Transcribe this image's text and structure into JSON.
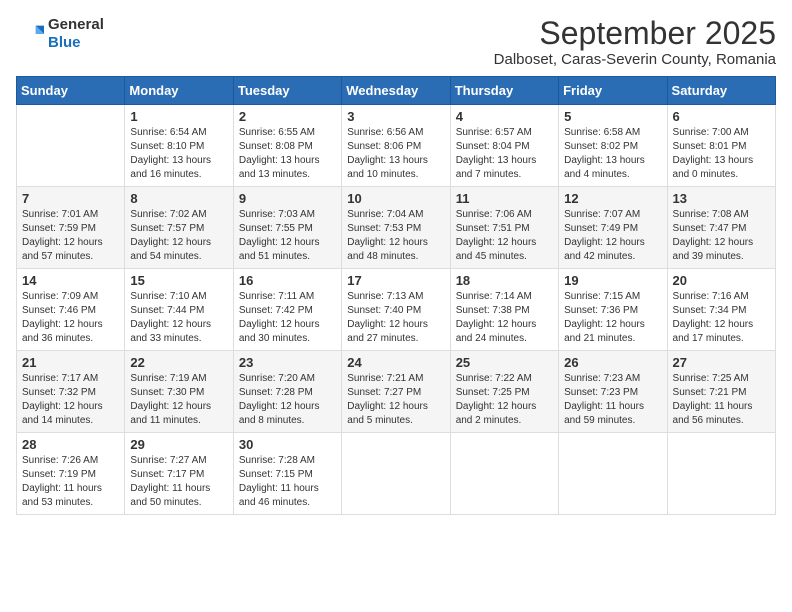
{
  "logo": {
    "general": "General",
    "blue": "Blue"
  },
  "header": {
    "month": "September 2025",
    "location": "Dalboset, Caras-Severin County, Romania"
  },
  "weekdays": [
    "Sunday",
    "Monday",
    "Tuesday",
    "Wednesday",
    "Thursday",
    "Friday",
    "Saturday"
  ],
  "weeks": [
    [
      {
        "day": "",
        "sunrise": "",
        "sunset": "",
        "daylight": ""
      },
      {
        "day": "1",
        "sunrise": "Sunrise: 6:54 AM",
        "sunset": "Sunset: 8:10 PM",
        "daylight": "Daylight: 13 hours and 16 minutes."
      },
      {
        "day": "2",
        "sunrise": "Sunrise: 6:55 AM",
        "sunset": "Sunset: 8:08 PM",
        "daylight": "Daylight: 13 hours and 13 minutes."
      },
      {
        "day": "3",
        "sunrise": "Sunrise: 6:56 AM",
        "sunset": "Sunset: 8:06 PM",
        "daylight": "Daylight: 13 hours and 10 minutes."
      },
      {
        "day": "4",
        "sunrise": "Sunrise: 6:57 AM",
        "sunset": "Sunset: 8:04 PM",
        "daylight": "Daylight: 13 hours and 7 minutes."
      },
      {
        "day": "5",
        "sunrise": "Sunrise: 6:58 AM",
        "sunset": "Sunset: 8:02 PM",
        "daylight": "Daylight: 13 hours and 4 minutes."
      },
      {
        "day": "6",
        "sunrise": "Sunrise: 7:00 AM",
        "sunset": "Sunset: 8:01 PM",
        "daylight": "Daylight: 13 hours and 0 minutes."
      }
    ],
    [
      {
        "day": "7",
        "sunrise": "Sunrise: 7:01 AM",
        "sunset": "Sunset: 7:59 PM",
        "daylight": "Daylight: 12 hours and 57 minutes."
      },
      {
        "day": "8",
        "sunrise": "Sunrise: 7:02 AM",
        "sunset": "Sunset: 7:57 PM",
        "daylight": "Daylight: 12 hours and 54 minutes."
      },
      {
        "day": "9",
        "sunrise": "Sunrise: 7:03 AM",
        "sunset": "Sunset: 7:55 PM",
        "daylight": "Daylight: 12 hours and 51 minutes."
      },
      {
        "day": "10",
        "sunrise": "Sunrise: 7:04 AM",
        "sunset": "Sunset: 7:53 PM",
        "daylight": "Daylight: 12 hours and 48 minutes."
      },
      {
        "day": "11",
        "sunrise": "Sunrise: 7:06 AM",
        "sunset": "Sunset: 7:51 PM",
        "daylight": "Daylight: 12 hours and 45 minutes."
      },
      {
        "day": "12",
        "sunrise": "Sunrise: 7:07 AM",
        "sunset": "Sunset: 7:49 PM",
        "daylight": "Daylight: 12 hours and 42 minutes."
      },
      {
        "day": "13",
        "sunrise": "Sunrise: 7:08 AM",
        "sunset": "Sunset: 7:47 PM",
        "daylight": "Daylight: 12 hours and 39 minutes."
      }
    ],
    [
      {
        "day": "14",
        "sunrise": "Sunrise: 7:09 AM",
        "sunset": "Sunset: 7:46 PM",
        "daylight": "Daylight: 12 hours and 36 minutes."
      },
      {
        "day": "15",
        "sunrise": "Sunrise: 7:10 AM",
        "sunset": "Sunset: 7:44 PM",
        "daylight": "Daylight: 12 hours and 33 minutes."
      },
      {
        "day": "16",
        "sunrise": "Sunrise: 7:11 AM",
        "sunset": "Sunset: 7:42 PM",
        "daylight": "Daylight: 12 hours and 30 minutes."
      },
      {
        "day": "17",
        "sunrise": "Sunrise: 7:13 AM",
        "sunset": "Sunset: 7:40 PM",
        "daylight": "Daylight: 12 hours and 27 minutes."
      },
      {
        "day": "18",
        "sunrise": "Sunrise: 7:14 AM",
        "sunset": "Sunset: 7:38 PM",
        "daylight": "Daylight: 12 hours and 24 minutes."
      },
      {
        "day": "19",
        "sunrise": "Sunrise: 7:15 AM",
        "sunset": "Sunset: 7:36 PM",
        "daylight": "Daylight: 12 hours and 21 minutes."
      },
      {
        "day": "20",
        "sunrise": "Sunrise: 7:16 AM",
        "sunset": "Sunset: 7:34 PM",
        "daylight": "Daylight: 12 hours and 17 minutes."
      }
    ],
    [
      {
        "day": "21",
        "sunrise": "Sunrise: 7:17 AM",
        "sunset": "Sunset: 7:32 PM",
        "daylight": "Daylight: 12 hours and 14 minutes."
      },
      {
        "day": "22",
        "sunrise": "Sunrise: 7:19 AM",
        "sunset": "Sunset: 7:30 PM",
        "daylight": "Daylight: 12 hours and 11 minutes."
      },
      {
        "day": "23",
        "sunrise": "Sunrise: 7:20 AM",
        "sunset": "Sunset: 7:28 PM",
        "daylight": "Daylight: 12 hours and 8 minutes."
      },
      {
        "day": "24",
        "sunrise": "Sunrise: 7:21 AM",
        "sunset": "Sunset: 7:27 PM",
        "daylight": "Daylight: 12 hours and 5 minutes."
      },
      {
        "day": "25",
        "sunrise": "Sunrise: 7:22 AM",
        "sunset": "Sunset: 7:25 PM",
        "daylight": "Daylight: 12 hours and 2 minutes."
      },
      {
        "day": "26",
        "sunrise": "Sunrise: 7:23 AM",
        "sunset": "Sunset: 7:23 PM",
        "daylight": "Daylight: 11 hours and 59 minutes."
      },
      {
        "day": "27",
        "sunrise": "Sunrise: 7:25 AM",
        "sunset": "Sunset: 7:21 PM",
        "daylight": "Daylight: 11 hours and 56 minutes."
      }
    ],
    [
      {
        "day": "28",
        "sunrise": "Sunrise: 7:26 AM",
        "sunset": "Sunset: 7:19 PM",
        "daylight": "Daylight: 11 hours and 53 minutes."
      },
      {
        "day": "29",
        "sunrise": "Sunrise: 7:27 AM",
        "sunset": "Sunset: 7:17 PM",
        "daylight": "Daylight: 11 hours and 50 minutes."
      },
      {
        "day": "30",
        "sunrise": "Sunrise: 7:28 AM",
        "sunset": "Sunset: 7:15 PM",
        "daylight": "Daylight: 11 hours and 46 minutes."
      },
      {
        "day": "",
        "sunrise": "",
        "sunset": "",
        "daylight": ""
      },
      {
        "day": "",
        "sunrise": "",
        "sunset": "",
        "daylight": ""
      },
      {
        "day": "",
        "sunrise": "",
        "sunset": "",
        "daylight": ""
      },
      {
        "day": "",
        "sunrise": "",
        "sunset": "",
        "daylight": ""
      }
    ]
  ]
}
